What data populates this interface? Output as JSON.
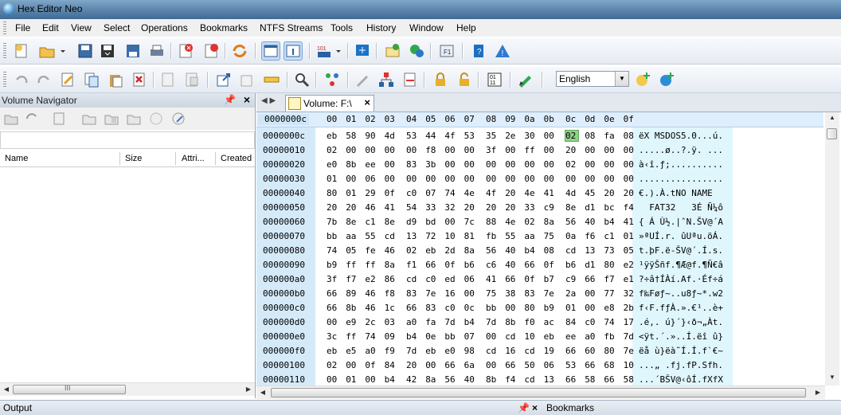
{
  "window": {
    "title": "Hex Editor Neo"
  },
  "menu": [
    "File",
    "Edit",
    "View",
    "Select",
    "Operations",
    "Bookmarks",
    "NTFS Streams",
    "Tools",
    "History",
    "Window",
    "Help"
  ],
  "toolbar": {
    "language": "English"
  },
  "volume_navigator": {
    "title": "Volume Navigator",
    "columns": [
      "Name",
      "Size",
      "Attri...",
      "Created"
    ],
    "scroll_glyph": "III"
  },
  "document": {
    "tab_label": "Volume: F:\\",
    "header_offset": "0000000c",
    "header_cols": [
      "00",
      "01",
      "02",
      "03",
      "04",
      "05",
      "06",
      "07",
      "08",
      "09",
      "0a",
      "0b",
      "0c",
      "0d",
      "0e",
      "0f"
    ],
    "rows": [
      {
        "off": "0000000c",
        "bytes": [
          "eb",
          "58",
          "90",
          "4d",
          "53",
          "44",
          "4f",
          "53",
          "35",
          "2e",
          "30",
          "00",
          "02",
          "08",
          "fa",
          "08"
        ],
        "ascii": "ëX MSDOS5.0...ú."
      },
      {
        "off": "00000010",
        "bytes": [
          "02",
          "00",
          "00",
          "00",
          "00",
          "f8",
          "00",
          "00",
          "3f",
          "00",
          "ff",
          "00",
          "20",
          "00",
          "00",
          "00"
        ],
        "ascii": ".....ø..?.ÿ. ..."
      },
      {
        "off": "00000020",
        "bytes": [
          "e0",
          "8b",
          "ee",
          "00",
          "83",
          "3b",
          "00",
          "00",
          "00",
          "00",
          "00",
          "00",
          "02",
          "00",
          "00",
          "00"
        ],
        "ascii": "à‹î.ƒ;.........."
      },
      {
        "off": "00000030",
        "bytes": [
          "01",
          "00",
          "06",
          "00",
          "00",
          "00",
          "00",
          "00",
          "00",
          "00",
          "00",
          "00",
          "00",
          "00",
          "00",
          "00"
        ],
        "ascii": "................"
      },
      {
        "off": "00000040",
        "bytes": [
          "80",
          "01",
          "29",
          "0f",
          "c0",
          "07",
          "74",
          "4e",
          "4f",
          "20",
          "4e",
          "41",
          "4d",
          "45",
          "20",
          "20"
        ],
        "ascii": "€.).À.tNO NAME  "
      },
      {
        "off": "00000050",
        "bytes": [
          "20",
          "20",
          "46",
          "41",
          "54",
          "33",
          "32",
          "20",
          "20",
          "20",
          "33",
          "c9",
          "8e",
          "d1",
          "bc",
          "f4"
        ],
        "ascii": "  FAT32   3É Ñ¼ô"
      },
      {
        "off": "00000060",
        "bytes": [
          "7b",
          "8e",
          "c1",
          "8e",
          "d9",
          "bd",
          "00",
          "7c",
          "88",
          "4e",
          "02",
          "8a",
          "56",
          "40",
          "b4",
          "41"
        ],
        "ascii": "{ Á Ù½.|ˆN.ŠV@´A"
      },
      {
        "off": "00000070",
        "bytes": [
          "bb",
          "aa",
          "55",
          "cd",
          "13",
          "72",
          "10",
          "81",
          "fb",
          "55",
          "aa",
          "75",
          "0a",
          "f6",
          "c1",
          "01"
        ],
        "ascii": "»ªUÍ.r. ûUªu.öÁ."
      },
      {
        "off": "00000080",
        "bytes": [
          "74",
          "05",
          "fe",
          "46",
          "02",
          "eb",
          "2d",
          "8a",
          "56",
          "40",
          "b4",
          "08",
          "cd",
          "13",
          "73",
          "05"
        ],
        "ascii": "t.þF.ë-ŠV@´.Í.s."
      },
      {
        "off": "00000090",
        "bytes": [
          "b9",
          "ff",
          "ff",
          "8a",
          "f1",
          "66",
          "0f",
          "b6",
          "c6",
          "40",
          "66",
          "0f",
          "b6",
          "d1",
          "80",
          "e2"
        ],
        "ascii": "¹ÿÿŠñf.¶Æ@f.¶Ñ€â"
      },
      {
        "off": "000000a0",
        "bytes": [
          "3f",
          "f7",
          "e2",
          "86",
          "cd",
          "c0",
          "ed",
          "06",
          "41",
          "66",
          "0f",
          "b7",
          "c9",
          "66",
          "f7",
          "e1"
        ],
        "ascii": "?÷â†ÍÀí.Af.·Éf÷á"
      },
      {
        "off": "000000b0",
        "bytes": [
          "66",
          "89",
          "46",
          "f8",
          "83",
          "7e",
          "16",
          "00",
          "75",
          "38",
          "83",
          "7e",
          "2a",
          "00",
          "77",
          "32"
        ],
        "ascii": "f‰Føƒ~..u8ƒ~*.w2"
      },
      {
        "off": "000000c0",
        "bytes": [
          "66",
          "8b",
          "46",
          "1c",
          "66",
          "83",
          "c0",
          "0c",
          "bb",
          "00",
          "80",
          "b9",
          "01",
          "00",
          "e8",
          "2b"
        ],
        "ascii": "f‹F.fƒÀ.».€¹..è+"
      },
      {
        "off": "000000d0",
        "bytes": [
          "00",
          "e9",
          "2c",
          "03",
          "a0",
          "fa",
          "7d",
          "b4",
          "7d",
          "8b",
          "f0",
          "ac",
          "84",
          "c0",
          "74",
          "17"
        ],
        "ascii": ".é,. ú}´}‹ð¬„Àt."
      },
      {
        "off": "000000e0",
        "bytes": [
          "3c",
          "ff",
          "74",
          "09",
          "b4",
          "0e",
          "bb",
          "07",
          "00",
          "cd",
          "10",
          "eb",
          "ee",
          "a0",
          "fb",
          "7d"
        ],
        "ascii": "<ÿt.´.»..Í.ëî û}"
      },
      {
        "off": "000000f0",
        "bytes": [
          "eb",
          "e5",
          "a0",
          "f9",
          "7d",
          "eb",
          "e0",
          "98",
          "cd",
          "16",
          "cd",
          "19",
          "66",
          "60",
          "80",
          "7e"
        ],
        "ascii": "ëå ù}ëà˜Í.Í.f`€~"
      },
      {
        "off": "00000100",
        "bytes": [
          "02",
          "00",
          "0f",
          "84",
          "20",
          "00",
          "66",
          "6a",
          "00",
          "66",
          "50",
          "06",
          "53",
          "66",
          "68",
          "10"
        ],
        "ascii": "...„ .fj.fP.Sfh."
      },
      {
        "off": "00000110",
        "bytes": [
          "00",
          "01",
          "00",
          "b4",
          "42",
          "8a",
          "56",
          "40",
          "8b",
          "f4",
          "cd",
          "13",
          "66",
          "58",
          "66",
          "58"
        ],
        "ascii": "...´BŠV@‹ôÍ.fXfX"
      }
    ],
    "selected_byte": {
      "row": 0,
      "col": 12
    }
  },
  "status": {
    "output": "Output",
    "bookmarks": "Bookmarks"
  },
  "colors": {
    "accent": "#3e6a93",
    "selection": "#8fd18a",
    "offset_bg": "#d4eaf9",
    "ascii_bg": "#dff6fc"
  }
}
